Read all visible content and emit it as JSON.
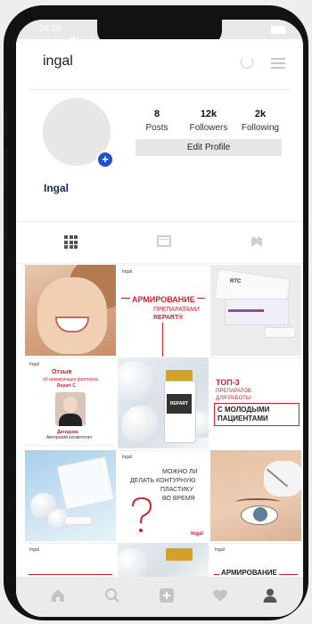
{
  "status_bar": {
    "time": "04:28"
  },
  "profile": {
    "username": "ingal",
    "display_name": "Ingal",
    "stats": [
      {
        "value": "8",
        "label": "Posts"
      },
      {
        "value": "12k",
        "label": "Followers"
      },
      {
        "value": "2k",
        "label": "Following"
      }
    ],
    "edit_profile_label": "Edit Profile"
  },
  "tabs": [
    "grid-icon",
    "feed-icon",
    "tagged-icon"
  ],
  "posts": {
    "p2": {
      "title_1": "АРМИРОВАНИЕ",
      "title_2": "ПРЕПАРАТАМИ",
      "title_3": "REPART®"
    },
    "p4": {
      "title_1": "Отзыв",
      "title_2": "об армирующих филлерах",
      "title_3": "Repart C",
      "person": "Дигидова",
      "role": "Авторский косметолог"
    },
    "p5": {
      "vial_label": "REPART"
    },
    "p6": {
      "title_1": "ТОП-3",
      "title_2": "ПРЕПАРАТОВ",
      "title_3": "ДЛЯ РАБОТЫ",
      "title_4": "С МОЛОДЫМИ",
      "title_5": "ПАЦИЕНТАМИ"
    },
    "p8": {
      "line_1": "МОЖНО ЛИ",
      "line_2": "ДЕЛАТЬ КОНТУРНУЮ",
      "line_3": "ПЛАСТИКУ",
      "line_4": "ВО ВРЕМЯ"
    },
    "p11": {
      "title": "АРМИРОВАНИЕ"
    },
    "brand_small": "Ingal",
    "brand_mark": "RTC"
  },
  "bottom_nav": [
    "home-icon",
    "search-icon",
    "add-post-icon",
    "heart-icon",
    "profile-icon"
  ],
  "colors": {
    "accent_red": "#d41f2b",
    "badge_blue": "#1f4fd1"
  }
}
